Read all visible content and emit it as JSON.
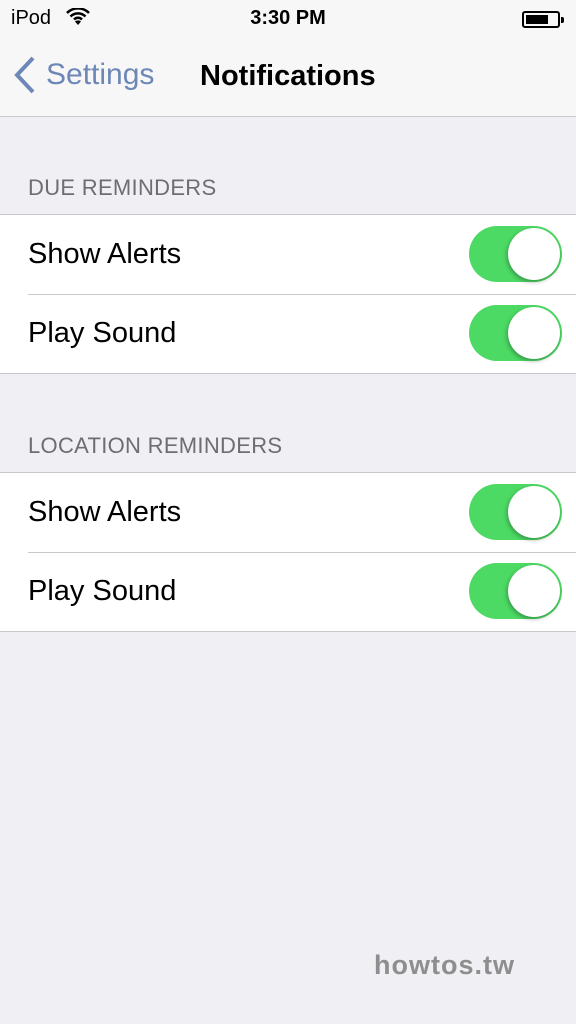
{
  "status_bar": {
    "carrier": "iPod",
    "time": "3:30 PM",
    "battery_level": 0.6
  },
  "nav": {
    "back_label": "Settings",
    "title": "Notifications"
  },
  "sections": [
    {
      "header": "DUE REMINDERS",
      "rows": [
        {
          "label": "Show Alerts",
          "on": true
        },
        {
          "label": "Play Sound",
          "on": true
        }
      ]
    },
    {
      "header": "LOCATION REMINDERS",
      "rows": [
        {
          "label": "Show Alerts",
          "on": true
        },
        {
          "label": "Play Sound",
          "on": true
        }
      ]
    }
  ],
  "watermark": "howtos.tw",
  "colors": {
    "toggle_on": "#4cd964",
    "tint": "#6d87b7"
  }
}
